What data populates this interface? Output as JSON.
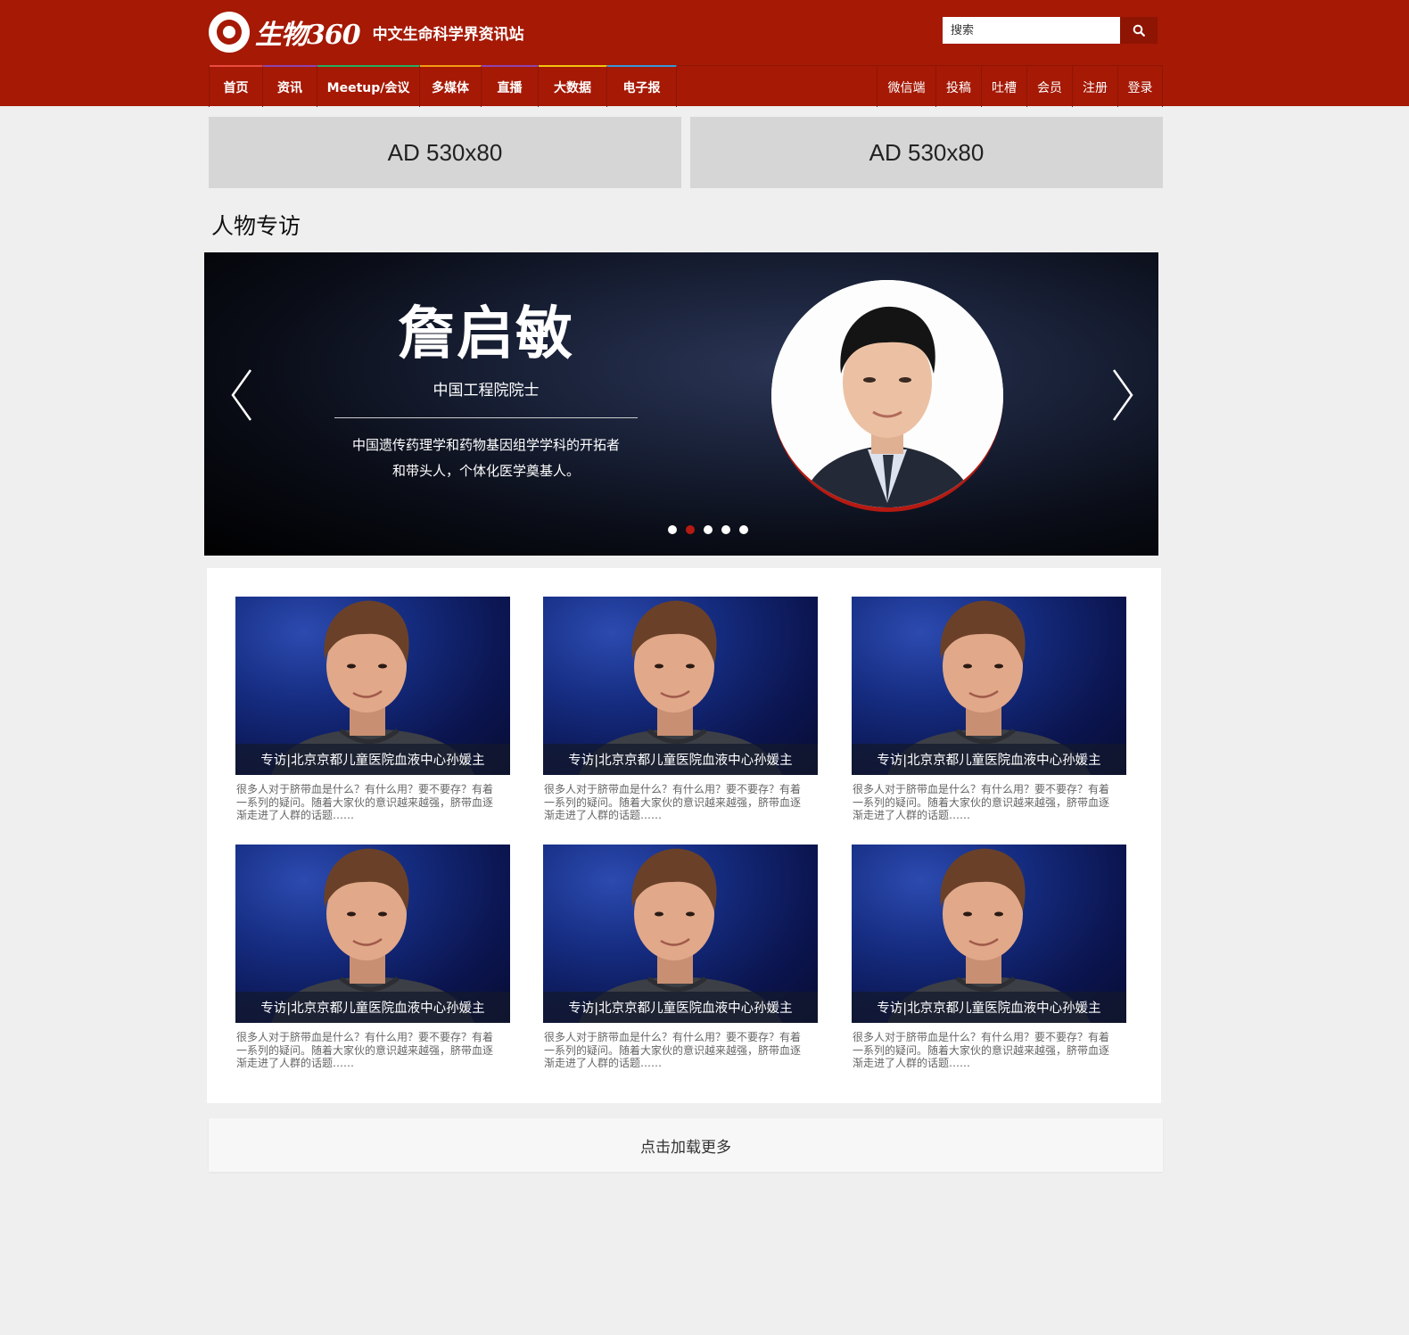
{
  "header": {
    "logo_script": "生物360",
    "tagline": "中文生命科学界资讯站",
    "search_placeholder": "搜索",
    "bg_color": "#a51905"
  },
  "nav": {
    "left": [
      {
        "label": "首页",
        "accent": "#e84b3c"
      },
      {
        "label": "资讯",
        "accent": "#8e44ad"
      },
      {
        "label": "Meetup/会议",
        "accent": "#27ae60"
      },
      {
        "label": "多媒体",
        "accent": "#f39c12"
      },
      {
        "label": "直播",
        "accent": "#8e44ad"
      },
      {
        "label": "大数据",
        "accent": "#f1c40f"
      },
      {
        "label": "电子报",
        "accent": "#3498db"
      }
    ],
    "right": [
      "微信端",
      "投稿",
      "吐槽",
      "会员",
      "注册",
      "登录"
    ]
  },
  "ads": [
    "AD 530x80",
    "AD 530x80"
  ],
  "section_title": "人物专访",
  "carousel": {
    "name": "詹启敏",
    "role": "中国工程院院士",
    "desc_line1": "中国遗传药理学和药物基因组学学科的开拓者",
    "desc_line2": "和带头人，个体化医学奠基人。",
    "dot_count": 5,
    "active_dot": 2,
    "accent": "#b61a12"
  },
  "cards": [
    {
      "caption": "专访|北京京都儿童医院血液中心孙媛主",
      "desc": "很多人对于脐带血是什么？有什么用？要不要存？有着一系列的疑问。随着大家伙的意识越来越强，脐带血逐渐走进了人群的话题……"
    },
    {
      "caption": "专访|北京京都儿童医院血液中心孙媛主",
      "desc": "很多人对于脐带血是什么？有什么用？要不要存？有着一系列的疑问。随着大家伙的意识越来越强，脐带血逐渐走进了人群的话题……"
    },
    {
      "caption": "专访|北京京都儿童医院血液中心孙媛主",
      "desc": "很多人对于脐带血是什么？有什么用？要不要存？有着一系列的疑问。随着大家伙的意识越来越强，脐带血逐渐走进了人群的话题……"
    },
    {
      "caption": "专访|北京京都儿童医院血液中心孙媛主",
      "desc": "很多人对于脐带血是什么？有什么用？要不要存？有着一系列的疑问。随着大家伙的意识越来越强，脐带血逐渐走进了人群的话题……"
    },
    {
      "caption": "专访|北京京都儿童医院血液中心孙媛主",
      "desc": "很多人对于脐带血是什么？有什么用？要不要存？有着一系列的疑问。随着大家伙的意识越来越强，脐带血逐渐走进了人群的话题……"
    },
    {
      "caption": "专访|北京京都儿童医院血液中心孙媛主",
      "desc": "很多人对于脐带血是什么？有什么用？要不要存？有着一系列的疑问。随着大家伙的意识越来越强，脐带血逐渐走进了人群的话题……"
    }
  ],
  "load_more": "点击加载更多"
}
